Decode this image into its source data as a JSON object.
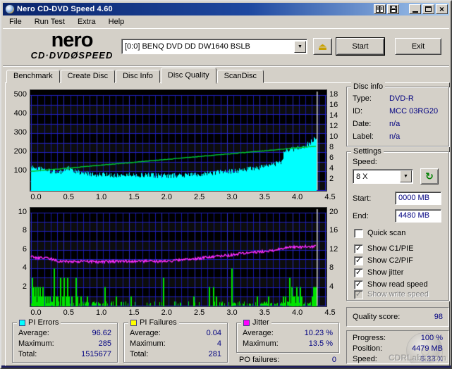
{
  "window": {
    "title": "Nero CD-DVD Speed 4.60"
  },
  "menu": {
    "items": [
      {
        "label": "File"
      },
      {
        "label": "Run Test"
      },
      {
        "label": "Extra"
      },
      {
        "label": "Help"
      }
    ]
  },
  "header": {
    "logo_nero": "nero",
    "logo_cd_dvd": "CD·DVD",
    "logo_glyph": "Ø",
    "logo_speed": "SPEED",
    "drive": "[0:0]   BENQ DVD DD DW1640 BSLB",
    "start_label": "Start",
    "exit_label": "Exit"
  },
  "tabs": {
    "items": [
      {
        "label": "Benchmark"
      },
      {
        "label": "Create Disc"
      },
      {
        "label": "Disc Info"
      },
      {
        "label": "Disc Quality"
      },
      {
        "label": "ScanDisc"
      }
    ],
    "active_index": 3
  },
  "disc_info": {
    "title": "Disc info",
    "rows": [
      {
        "label": "Type:",
        "value": "DVD-R"
      },
      {
        "label": "ID:",
        "value": "MCC 03RG20"
      },
      {
        "label": "Date:",
        "value": "n/a"
      },
      {
        "label": "Label:",
        "value": "n/a"
      }
    ]
  },
  "settings": {
    "title": "Settings",
    "speed_label": "Speed:",
    "speed_value": "8 X",
    "start_label": "Start:",
    "start_value": "0000 MB",
    "end_label": "End:",
    "end_value": "4480 MB",
    "checkboxes": [
      {
        "label": "Quick scan",
        "checked": false,
        "enabled": true
      },
      {
        "label": "Show C1/PIE",
        "checked": true,
        "enabled": true
      },
      {
        "label": "Show C2/PIF",
        "checked": true,
        "enabled": true
      },
      {
        "label": "Show jitter",
        "checked": true,
        "enabled": true
      },
      {
        "label": "Show read speed",
        "checked": true,
        "enabled": true
      },
      {
        "label": "Show write speed",
        "checked": true,
        "enabled": false
      }
    ]
  },
  "quality": {
    "label": "Quality score:",
    "value": "98"
  },
  "progress": {
    "rows": [
      {
        "label": "Progress:",
        "value": "100 %"
      },
      {
        "label": "Position:",
        "value": "4479 MB"
      },
      {
        "label": "Speed:",
        "value": "8.33 X"
      }
    ],
    "watermark": "CDRLabs.com"
  },
  "stats": {
    "pi_errors": {
      "title": "PI Errors",
      "swatch": "#00FFFF",
      "rows": [
        {
          "label": "Average:",
          "value": "96.62"
        },
        {
          "label": "Maximum:",
          "value": "285"
        },
        {
          "label": "Total:",
          "value": "1515677"
        }
      ]
    },
    "pi_failures": {
      "title": "PI Failures",
      "swatch": "#FFFF00",
      "rows": [
        {
          "label": "Average:",
          "value": "0.04"
        },
        {
          "label": "Maximum:",
          "value": "4"
        },
        {
          "label": "Total:",
          "value": "281"
        }
      ]
    },
    "jitter": {
      "title": "Jitter",
      "swatch": "#FF00FF",
      "rows": [
        {
          "label": "Average:",
          "value": "10.23 %"
        },
        {
          "label": "Maximum:",
          "value": "13.5 %"
        }
      ]
    },
    "po_failures": {
      "label": "PO failures:",
      "value": "0"
    }
  },
  "chart_data": [
    {
      "type": "area",
      "name": "pi-errors-and-read-speed",
      "x_range": [
        0,
        4.5
      ],
      "x_ticks": [
        "0.0",
        "0.5",
        "1.0",
        "1.5",
        "2.0",
        "2.5",
        "3.0",
        "3.5",
        "4.0",
        "4.5"
      ],
      "left_axis": {
        "range": [
          0,
          500
        ],
        "ticks": [
          500,
          400,
          300,
          200,
          100
        ],
        "grid_step": 50
      },
      "right_axis": {
        "range": [
          0,
          18
        ],
        "ticks": [
          18,
          16,
          14,
          12,
          10,
          8,
          6,
          4,
          2
        ]
      },
      "x_grid_minor": 0.1,
      "x_grid_major": 0.5,
      "position_marker_x": 4.37,
      "series": [
        {
          "name": "pi_errors",
          "style": "area",
          "axis": "left",
          "color": "#00FFFF",
          "noise": 13,
          "end_x": 4.37,
          "points": [
            [
              0,
              122
            ],
            [
              0.1,
              115
            ],
            [
              0.2,
              108
            ],
            [
              0.3,
              100
            ],
            [
              0.45,
              95
            ],
            [
              0.55,
              118
            ],
            [
              0.65,
              100
            ],
            [
              0.8,
              88
            ],
            [
              1.0,
              82
            ],
            [
              1.2,
              78
            ],
            [
              1.5,
              80
            ],
            [
              1.8,
              78
            ],
            [
              2.0,
              75
            ],
            [
              2.3,
              78
            ],
            [
              2.6,
              85
            ],
            [
              2.9,
              95
            ],
            [
              3.1,
              100
            ],
            [
              3.3,
              110
            ],
            [
              3.5,
              120
            ],
            [
              3.65,
              130
            ],
            [
              3.8,
              145
            ],
            [
              3.84,
              150
            ],
            [
              3.87,
              208
            ],
            [
              4.0,
              215
            ],
            [
              4.1,
              225
            ],
            [
              4.2,
              235
            ],
            [
              4.27,
              250
            ],
            [
              4.32,
              263
            ],
            [
              4.35,
              278
            ],
            [
              4.37,
              272
            ]
          ]
        },
        {
          "name": "read_speed",
          "style": "line",
          "axis": "right",
          "color": "#00C832",
          "noise": 0.05,
          "end_x": 4.37,
          "points": [
            [
              0,
              3.55
            ],
            [
              4.37,
              8.33
            ]
          ]
        }
      ]
    },
    {
      "type": "bars",
      "name": "pi-failures-and-jitter",
      "x_range": [
        0,
        4.5
      ],
      "x_ticks": [
        "0.0",
        "0.5",
        "1.0",
        "1.5",
        "2.0",
        "2.5",
        "3.0",
        "3.5",
        "4.0",
        "4.5"
      ],
      "left_axis": {
        "range": [
          0,
          10
        ],
        "ticks": [
          10,
          8,
          6,
          4,
          2
        ],
        "grid_step": 1
      },
      "right_axis": {
        "range": [
          0,
          20
        ],
        "ticks": [
          20,
          16,
          12,
          8,
          4
        ]
      },
      "x_grid_minor": 0.1,
      "x_grid_major": 0.5,
      "position_marker_x": 4.37,
      "series": [
        {
          "name": "pi_failures",
          "style": "bars",
          "axis": "left",
          "color": "#00E400",
          "baseline": [
            [
              0,
              0.3,
              0.8
            ],
            [
              0.3,
              1.3,
              0.38
            ],
            [
              1.3,
              2.6,
              0.17
            ],
            [
              2.6,
              3.5,
              0.3
            ],
            [
              3.5,
              4.37,
              0.5
            ]
          ],
          "points": [
            [
              0.01,
              3
            ],
            [
              0.03,
              2
            ],
            [
              0.05,
              1
            ],
            [
              0.07,
              2
            ],
            [
              0.1,
              2
            ],
            [
              0.12,
              1
            ],
            [
              0.13,
              2
            ],
            [
              0.15,
              1
            ],
            [
              0.17,
              2
            ],
            [
              0.18,
              1
            ],
            [
              0.22,
              1
            ],
            [
              0.25,
              1
            ],
            [
              0.28,
              1
            ],
            [
              0.33,
              1
            ],
            [
              0.35,
              4
            ],
            [
              0.38,
              1
            ],
            [
              0.4,
              1
            ],
            [
              0.44,
              3
            ],
            [
              0.47,
              1
            ],
            [
              0.5,
              3
            ],
            [
              0.53,
              1
            ],
            [
              0.55,
              3
            ],
            [
              0.57,
              1
            ],
            [
              0.62,
              1
            ],
            [
              0.68,
              3
            ],
            [
              0.7,
              1
            ],
            [
              0.75,
              1
            ],
            [
              0.85,
              1
            ],
            [
              1.12,
              2
            ],
            [
              1.3,
              1
            ],
            [
              1.52,
              1
            ],
            [
              2.02,
              3
            ],
            [
              2.48,
              1
            ],
            [
              2.72,
              2
            ],
            [
              2.78,
              2
            ],
            [
              2.83,
              1
            ],
            [
              3.06,
              4
            ],
            [
              3.45,
              1
            ],
            [
              3.63,
              1
            ],
            [
              3.85,
              1
            ],
            [
              3.88,
              1
            ],
            [
              3.95,
              3
            ],
            [
              3.98,
              2
            ],
            [
              4.0,
              1
            ],
            [
              4.02,
              1
            ],
            [
              4.06,
              2
            ],
            [
              4.08,
              1
            ],
            [
              4.11,
              2
            ],
            [
              4.13,
              1
            ],
            [
              4.3,
              1
            ],
            [
              4.32,
              2
            ],
            [
              4.34,
              2
            ],
            [
              4.36,
              2
            ]
          ]
        },
        {
          "name": "jitter",
          "style": "line",
          "axis": "right",
          "color": "#FF2BFF",
          "noise": 0.28,
          "end_x": 4.37,
          "points": [
            [
              0,
              10.6
            ],
            [
              0.1,
              10.2
            ],
            [
              0.25,
              10.3
            ],
            [
              0.4,
              9.6
            ],
            [
              0.6,
              9.5
            ],
            [
              0.8,
              9.5
            ],
            [
              1.0,
              9.4
            ],
            [
              1.3,
              9.5
            ],
            [
              1.6,
              9.6
            ],
            [
              1.9,
              9.5
            ],
            [
              2.1,
              9.6
            ],
            [
              2.4,
              9.9
            ],
            [
              2.7,
              10.4
            ],
            [
              3.0,
              10.8
            ],
            [
              3.2,
              11.2
            ],
            [
              3.5,
              11.6
            ],
            [
              3.7,
              11.9
            ],
            [
              3.9,
              12.5
            ],
            [
              4.0,
              12.6
            ],
            [
              4.1,
              12.5
            ],
            [
              4.2,
              12.7
            ],
            [
              4.3,
              12.6
            ],
            [
              4.37,
              13.1
            ]
          ]
        }
      ]
    }
  ]
}
